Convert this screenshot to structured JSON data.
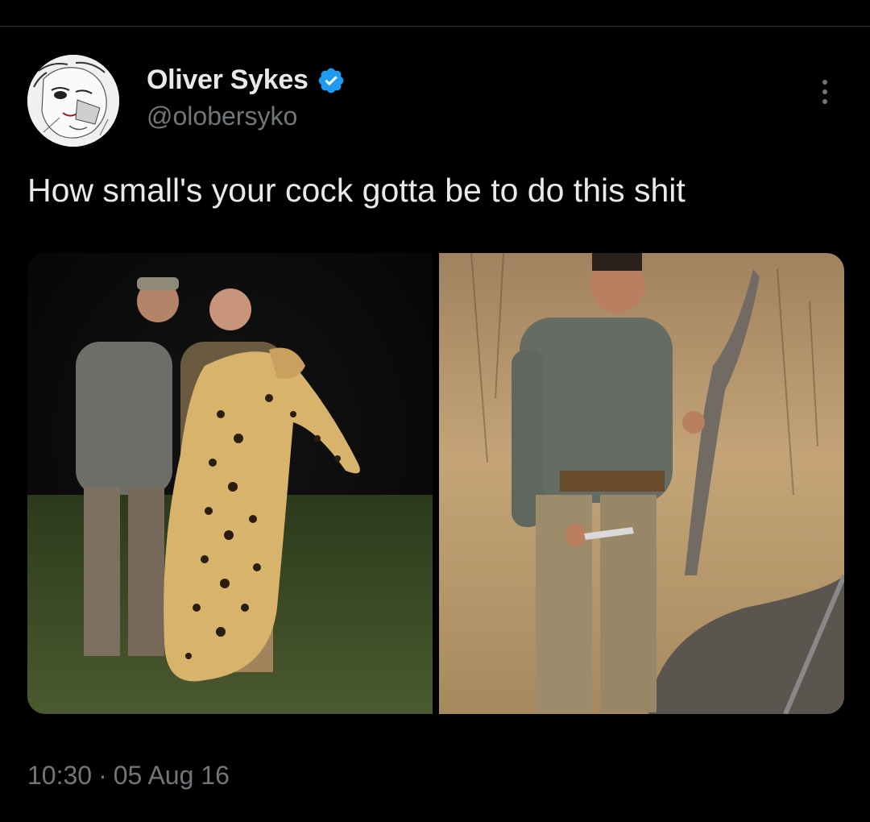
{
  "tweet": {
    "author": {
      "display_name": "Oliver Sykes",
      "handle": "@olobersyko",
      "verified": true
    },
    "text": "How small's your cock gotta be to do this shit",
    "media": [
      {
        "icon": "photo-leopard-hunters"
      },
      {
        "icon": "photo-elephant-tail"
      }
    ],
    "time": "10:30",
    "separator": "·",
    "date": "05 Aug 16"
  },
  "colors": {
    "background": "#000000",
    "primary_text": "#e7e9ea",
    "secondary_text": "#71767b",
    "verified_blue": "#1d9bf0"
  }
}
